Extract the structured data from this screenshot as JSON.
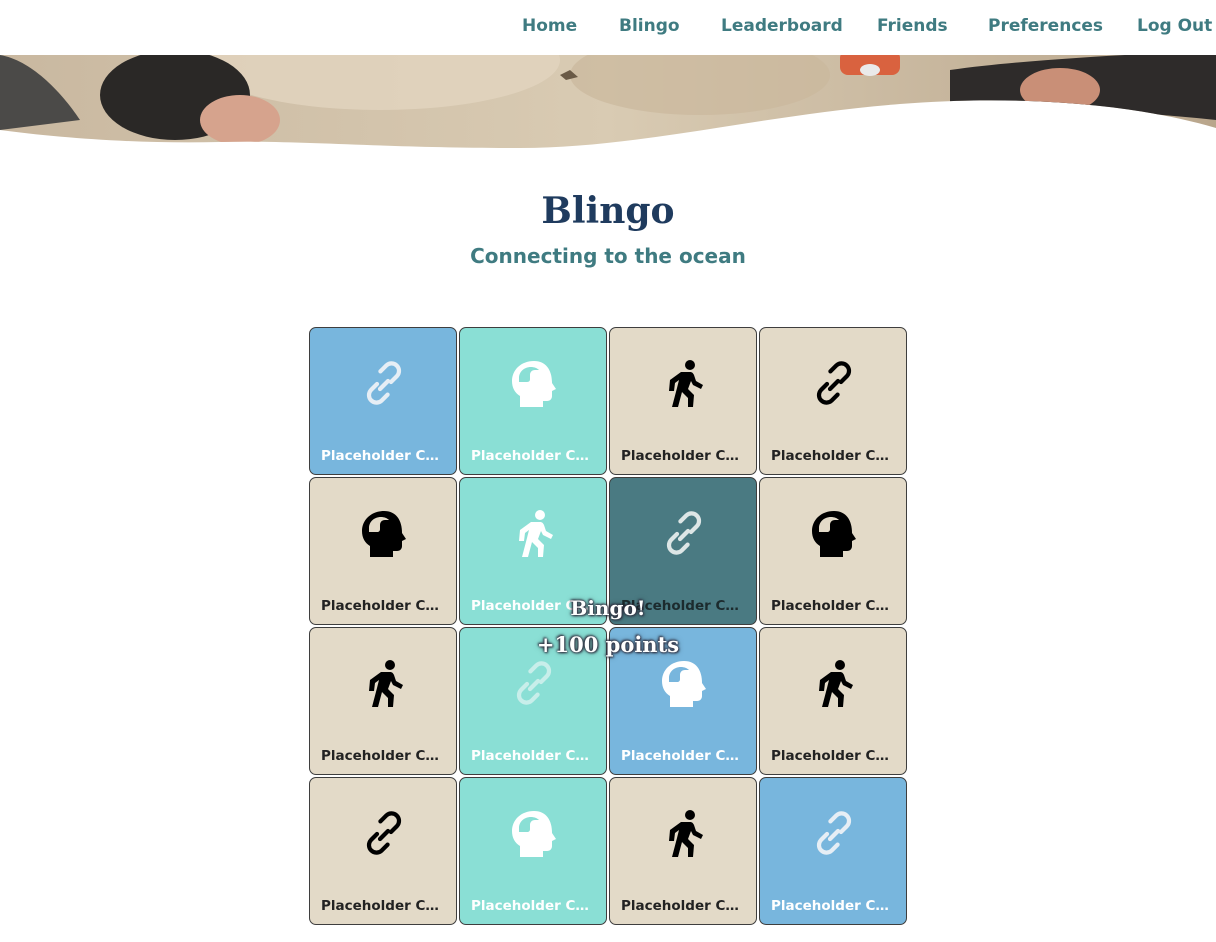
{
  "nav": {
    "home": "Home",
    "blingo": "Blingo",
    "leaderboard": "Leaderboard",
    "friends": "Friends",
    "preferences": "Preferences",
    "logout": "Log Out"
  },
  "page": {
    "title": "Blingo",
    "subtitle": "Connecting to the ocean"
  },
  "bingo_popup": {
    "title": "Bingo!",
    "points": "+100 points"
  },
  "colors": {
    "sand": "#e3dac8",
    "teal_light": "#8adfd5",
    "blue_light": "#78b6dd",
    "teal_dark": "#4a7a82",
    "brand_dark": "#1f3b5e",
    "brand_teal": "#3f7b81"
  },
  "tiles": [
    {
      "label": "Placeholder Challenge",
      "icon": "link-icon",
      "color": "#78b6dd",
      "fg": "#ffffff",
      "icon_fg": "#e6eef5"
    },
    {
      "label": "Placeholder Challenge",
      "icon": "head-icon",
      "color": "#8adfd5",
      "fg": "#ffffff",
      "icon_fg": "#ffffff"
    },
    {
      "label": "Placeholder Challenge",
      "icon": "walk-icon",
      "color": "#e3dac8",
      "fg": "#222222",
      "icon_fg": "#000000"
    },
    {
      "label": "Placeholder Challenge",
      "icon": "link-icon",
      "color": "#e3dac8",
      "fg": "#222222",
      "icon_fg": "#000000"
    },
    {
      "label": "Placeholder Challenge",
      "icon": "head-icon",
      "color": "#e3dac8",
      "fg": "#222222",
      "icon_fg": "#000000"
    },
    {
      "label": "Placeholder Challenge",
      "icon": "walk-icon",
      "color": "#8adfd5",
      "fg": "#ffffff",
      "icon_fg": "#ffffff"
    },
    {
      "label": "Placeholder Challenge",
      "icon": "link-icon",
      "color": "#4a7a82",
      "fg": "#1c2b2e",
      "icon_fg": "#dde6e6"
    },
    {
      "label": "Placeholder Challenge",
      "icon": "head-icon",
      "color": "#e3dac8",
      "fg": "#222222",
      "icon_fg": "#000000"
    },
    {
      "label": "Placeholder Challenge",
      "icon": "walk-icon",
      "color": "#e3dac8",
      "fg": "#222222",
      "icon_fg": "#000000"
    },
    {
      "label": "Placeholder Challenge",
      "icon": "link-icon",
      "color": "#8adfd5",
      "fg": "#ffffff",
      "icon_fg": "#c8eeea"
    },
    {
      "label": "Placeholder Challenge",
      "icon": "head-icon",
      "color": "#78b6dd",
      "fg": "#ffffff",
      "icon_fg": "#ffffff"
    },
    {
      "label": "Placeholder Challenge",
      "icon": "walk-icon",
      "color": "#e3dac8",
      "fg": "#222222",
      "icon_fg": "#000000"
    },
    {
      "label": "Placeholder Challenge",
      "icon": "link-icon",
      "color": "#e3dac8",
      "fg": "#222222",
      "icon_fg": "#000000"
    },
    {
      "label": "Placeholder Challenge",
      "icon": "head-icon",
      "color": "#8adfd5",
      "fg": "#ffffff",
      "icon_fg": "#ffffff"
    },
    {
      "label": "Placeholder Challenge",
      "icon": "walk-icon",
      "color": "#e3dac8",
      "fg": "#222222",
      "icon_fg": "#000000"
    },
    {
      "label": "Placeholder Challenge",
      "icon": "link-icon",
      "color": "#78b6dd",
      "fg": "#ffffff",
      "icon_fg": "#e6eef5"
    }
  ]
}
